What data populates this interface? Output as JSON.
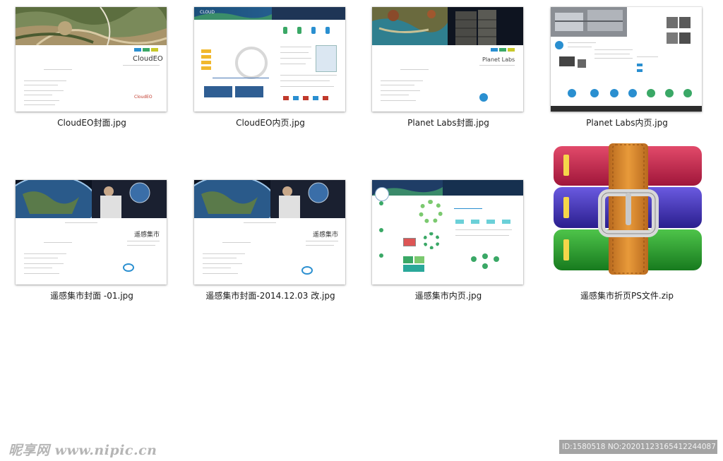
{
  "files": [
    {
      "name": "CloudEO封面.jpg",
      "thumb": {
        "brand": "CloudEO"
      }
    },
    {
      "name": "CloudEO内页.jpg",
      "thumb": {
        "brand": "CLOUD"
      }
    },
    {
      "name": "Planet Labs封面.jpg",
      "thumb": {
        "brand": "Planet Labs"
      }
    },
    {
      "name": "Planet Labs内页.jpg",
      "thumb": {}
    },
    {
      "name": "遥感集市封面 -01.jpg",
      "thumb": {
        "brand": "遥感集市"
      }
    },
    {
      "name": "遥感集市封面-2014.12.03 改.jpg",
      "thumb": {
        "brand": "遥感集市"
      }
    },
    {
      "name": "遥感集市内页.jpg",
      "thumb": {}
    },
    {
      "name": "遥感集市折页PS文件.zip",
      "thumb": {}
    }
  ],
  "watermark": {
    "left_text": "昵享网 www.nipic.cn",
    "right_text": "ID:1580518 NO:20201123165412244087"
  }
}
